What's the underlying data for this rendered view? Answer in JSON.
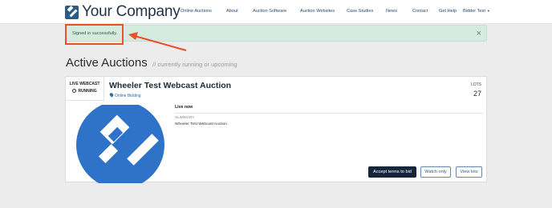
{
  "brand": {
    "name": "Your Company",
    "color": "#2a5c88"
  },
  "nav": {
    "items": [
      {
        "label": "Online Auctions"
      },
      {
        "label": "About"
      },
      {
        "label": "Auction Software"
      },
      {
        "label": "Auction Websites"
      },
      {
        "label": "Case Studies"
      },
      {
        "label": "News"
      },
      {
        "label": "Contact"
      },
      {
        "label": "Get Help"
      },
      {
        "label": "Bidder Test",
        "icon": "caret-down-icon"
      }
    ]
  },
  "alert": {
    "message": "Signed in successfully.",
    "close_icon": "close-icon"
  },
  "page": {
    "title": "Active Auctions",
    "subtitle": "// currently running or upcoming"
  },
  "auction": {
    "type_label": "LIVE WEBCAST",
    "status": "RUNNING",
    "title": "Wheeler Test Webcast Auction",
    "bidding_type": "Online Bidding",
    "lots_label": "LOTS",
    "lots_count": "27",
    "live_label": "Live now",
    "summary_label": "SUMMARY",
    "summary_text": "Wheeler Test Webcast Auction",
    "buttons": {
      "accept": "Accept terms to bid",
      "watch": "Watch only",
      "view": "View lots"
    }
  },
  "colors": {
    "alert_bg": "#d6ebe0",
    "primary_button": "#15253a",
    "link": "#2a6bb0",
    "annotation": "#e8512a",
    "logo_circle": "#2e73c8"
  }
}
